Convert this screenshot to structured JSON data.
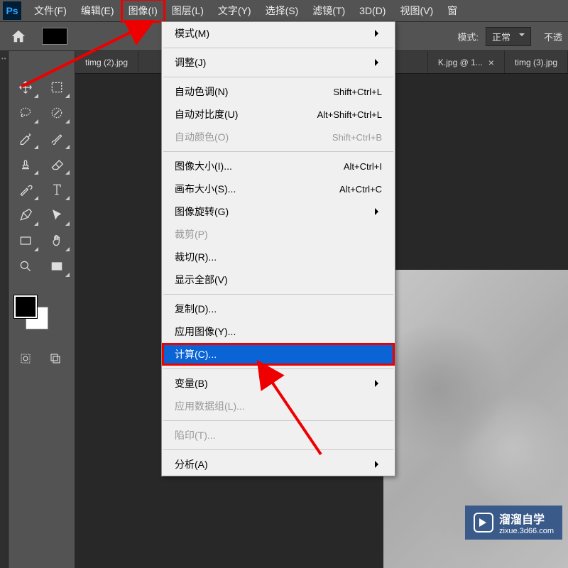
{
  "menubar": {
    "items": [
      {
        "label": "文件(F)"
      },
      {
        "label": "编辑(E)"
      },
      {
        "label": "图像(I)",
        "highlighted": true
      },
      {
        "label": "图层(L)"
      },
      {
        "label": "文字(Y)"
      },
      {
        "label": "选择(S)"
      },
      {
        "label": "滤镜(T)"
      },
      {
        "label": "3D(D)"
      },
      {
        "label": "视图(V)"
      },
      {
        "label": "窗"
      }
    ]
  },
  "toolbar": {
    "mode_label": "模式:",
    "mode_value": "正常",
    "opacity_label": "不透"
  },
  "tabs": {
    "items": [
      {
        "label": "timg (2).jpg"
      },
      {
        "label": "K.jpg @ 1..."
      },
      {
        "label": "timg (3).jpg"
      }
    ]
  },
  "dropdown": {
    "groups": [
      {
        "items": [
          {
            "label": "模式(M)",
            "submenu": true
          }
        ]
      },
      {
        "items": [
          {
            "label": "调整(J)",
            "submenu": true
          }
        ]
      },
      {
        "items": [
          {
            "label": "自动色调(N)",
            "shortcut": "Shift+Ctrl+L"
          },
          {
            "label": "自动对比度(U)",
            "shortcut": "Alt+Shift+Ctrl+L"
          },
          {
            "label": "自动颜色(O)",
            "shortcut": "Shift+Ctrl+B",
            "disabled": true
          }
        ]
      },
      {
        "items": [
          {
            "label": "图像大小(I)...",
            "shortcut": "Alt+Ctrl+I"
          },
          {
            "label": "画布大小(S)...",
            "shortcut": "Alt+Ctrl+C"
          },
          {
            "label": "图像旋转(G)",
            "submenu": true
          },
          {
            "label": "裁剪(P)",
            "disabled": true
          },
          {
            "label": "裁切(R)..."
          },
          {
            "label": "显示全部(V)"
          }
        ]
      },
      {
        "items": [
          {
            "label": "复制(D)..."
          },
          {
            "label": "应用图像(Y)..."
          },
          {
            "label": "计算(C)...",
            "selected": true,
            "highlighted": true
          }
        ]
      },
      {
        "items": [
          {
            "label": "变量(B)",
            "submenu": true
          },
          {
            "label": "应用数据组(L)...",
            "disabled": true
          }
        ]
      },
      {
        "items": [
          {
            "label": "陷印(T)...",
            "disabled": true
          }
        ]
      },
      {
        "items": [
          {
            "label": "分析(A)",
            "submenu": true
          }
        ]
      }
    ]
  },
  "watermark": {
    "title": "溜溜自学",
    "subtitle": "zixue.3d66.com"
  },
  "colors": {
    "accent": "#0a64d6",
    "highlight": "#e00000"
  }
}
